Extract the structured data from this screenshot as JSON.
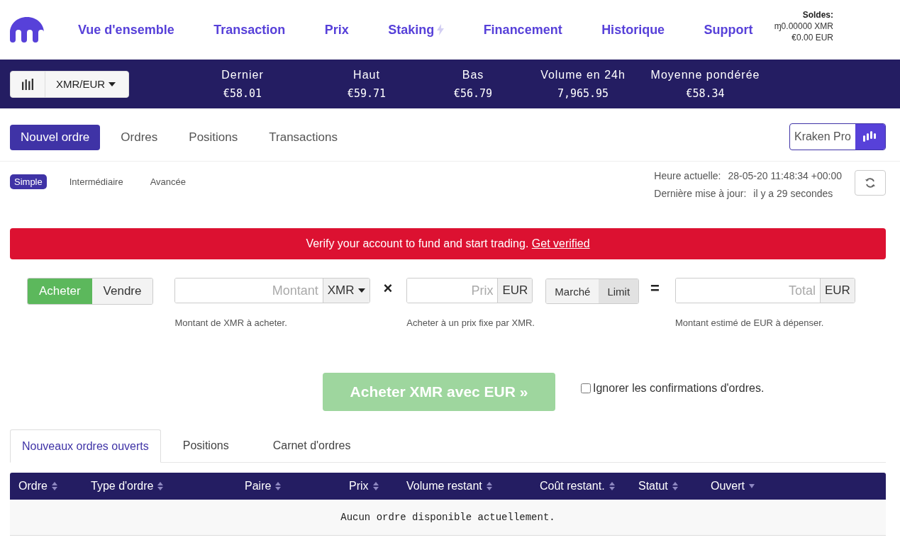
{
  "nav": [
    {
      "label": "Vue d'ensemble",
      "kind": "plain"
    },
    {
      "label": "Transaction",
      "kind": "plain"
    },
    {
      "label": "Prix",
      "kind": "plain"
    },
    {
      "label": "Staking",
      "kind": "bolt"
    },
    {
      "label": "Financement",
      "kind": "plain"
    },
    {
      "label": "Historique",
      "kind": "plain"
    },
    {
      "label": "Support",
      "kind": "plain"
    }
  ],
  "balances": {
    "title": "Soldes:",
    "lines": [
      "ɱ0.00000 XMR",
      "€0.00 EUR"
    ]
  },
  "ticker": {
    "pair": "XMR/EUR",
    "stats": [
      {
        "label": "Dernier",
        "value": "€58.01"
      },
      {
        "label": "Haut",
        "value": "€59.71"
      },
      {
        "label": "Bas",
        "value": "€56.79"
      },
      {
        "label": "Volume en 24h",
        "value": "7,965.95"
      },
      {
        "label": "Moyenne pondérée",
        "value": "€58.34"
      }
    ]
  },
  "tabs": [
    {
      "label": "Nouvel ordre",
      "selected": true
    },
    {
      "label": "Ordres",
      "selected": false
    },
    {
      "label": "Positions",
      "selected": false
    },
    {
      "label": "Transactions",
      "selected": false
    }
  ],
  "kraken_pro": "Kraken Pro",
  "modes": [
    {
      "label": "Simple",
      "selected": true
    },
    {
      "label": "Intermédiaire",
      "selected": false
    },
    {
      "label": "Avancée",
      "selected": false
    }
  ],
  "time": [
    {
      "label": "Heure actuelle:",
      "value": "28-05-20 11:48:34 +00:00"
    },
    {
      "label": "Dernière mise à jour:",
      "value": "il y a 29 secondes"
    }
  ],
  "alert": {
    "text": "Verify your account to fund and start trading.",
    "link": "Get verified"
  },
  "side": [
    {
      "label": "Acheter",
      "selected": true
    },
    {
      "label": "Vendre",
      "selected": false
    }
  ],
  "amount": {
    "placeholder": "Montant",
    "unit": "XMR",
    "help": "Montant de XMR à acheter."
  },
  "times_sign": "×",
  "price": {
    "placeholder": "Prix",
    "unit": "EUR",
    "help": "Acheter à un prix fixe par XMR."
  },
  "order_type": [
    {
      "label": "Marché",
      "selected": false
    },
    {
      "label": "Limit",
      "selected": true
    }
  ],
  "equals_sign": "=",
  "total": {
    "placeholder": "Total",
    "unit": "EUR",
    "help": "Montant estimé de EUR à dépenser."
  },
  "submit": {
    "label": "Acheter XMR avec EUR »",
    "disabled": true
  },
  "skip_confirm": {
    "label": "Ignorer les confirmations d'ordres.",
    "checked": false
  },
  "bottom_tabs": [
    {
      "label": "Nouveaux ordres ouverts",
      "selected": true
    },
    {
      "label": "Positions",
      "selected": false
    },
    {
      "label": "Carnet d'ordres",
      "selected": false
    }
  ],
  "table": {
    "columns": [
      {
        "label": "Ordre",
        "sorted": false
      },
      {
        "label": "Type d'ordre",
        "sorted": false
      },
      {
        "label": "Paire",
        "sorted": false
      },
      {
        "label": "Prix",
        "sorted": false
      },
      {
        "label": "Volume restant",
        "sorted": false
      },
      {
        "label": "Coût restant.",
        "sorted": false
      },
      {
        "label": "Statut",
        "sorted": false
      },
      {
        "label": "Ouvert",
        "sorted": true
      }
    ],
    "empty": "Aucun ordre disponible actuellement."
  }
}
